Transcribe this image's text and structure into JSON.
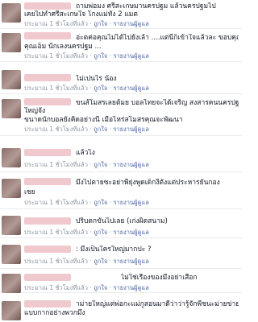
{
  "comments": [
    {
      "lines": [
        "ถามพ่อมง ศรีสะเกษมานครปฐม แล้วนครปฐมไป",
        "เคยไปทำศรีสะเกษใจ โกงแม่ทั้ง 2 แมต"
      ],
      "time": "ประมาณ 1 ชั่วโมงที่แล้ว",
      "like": "ถูกใจ",
      "report": "รายงานผู้ดูแล"
    },
    {
      "lines": [
        "อ่ะตค่อคุณไม่ได้ไปยังเล้า ....แต่นี้ก็เข้าใจแล้วละ ขอบคุณมากคุณดร",
        "คุณเอ็ม นักเลงนครปฐม ..."
      ],
      "time": "ประมาณ 1 ชั่วโมงที่แล้ว",
      "like": "ถูกใจ",
      "report": "รายงานผู้ดูแล"
    },
    {
      "lines": [
        "ไม่เปนไร น้อง"
      ],
      "time": "ประมาณ 1 ชั่วโมงที่แล้ว",
      "like": "ถูกใจ",
      "report": "รายงานผู้ดูแล"
    },
    {
      "lines": [
        "ขนส์โมสรเลยต้มย บอลไทยจะได้เจริญ สงสารคนนครปฐมส่วน",
        "ใหญ่จัง",
        "ขนาดนักบอลยังคิดอย่างนี้ เมื่อไหร่สโมสรคุณจะพัฒนา"
      ],
      "time": "ประมาณ 1 ชั่วโมงที่แล้ว",
      "like": "ถูกใจ",
      "report": "รายงานผู้ดูแล"
    },
    {
      "lines": [
        "แล้วไง"
      ],
      "time": "ประมาณ 1 ชั่วโมงที่แล้ว",
      "like": "ถูกใจ",
      "report": "รายงานผู้ดูแล"
    },
    {
      "lines": [
        "มึงไปตายซะอย่าพี่ยุ่งพูดเด็กงี้ตั้งแต่ประหารยันกอง",
        "เชย"
      ],
      "time": "ประมาณ 1 ชั่วโมงที่แล้ว",
      "like": "ถูกใจ",
      "report": "รายงานผู้ดูแล"
    },
    {
      "lines": [
        "ปริบตกขั้นไปเลย (เก่งผิดสนาม)"
      ],
      "time": "ประมาณ 1 ชั่วโมงที่แล้ว",
      "like": "ถูกใจ",
      "report": "รายงานผู้ดูแล"
    },
    {
      "lines": [
        ": มึงเป็นใครใหญ่มากปะ ?"
      ],
      "time": "ประมาณ 1 ชั่วโมงที่แล้ว",
      "like": "ถูกใจ",
      "report": "รายงานผู้ดูแล"
    },
    {
      "lines": [
        "ไม่ใช่เรื่องของมึงอย่าเสือก"
      ],
      "time": "ประมาณ 1 ชั่วโมงที่แล้ว",
      "like": "ถูกใจ",
      "report": "รายงานผู้ดูแล"
    },
    {
      "lines": [
        "าม่ายใหญ่แต่พ่อกะแม่กูสอนมาดีว่าว่ารู้จักพี่ชนะม่ายข่ายพี่ใหญ่",
        "แบบกากอย่างพวกมึง"
      ],
      "time": "",
      "like": "",
      "report": ""
    }
  ]
}
